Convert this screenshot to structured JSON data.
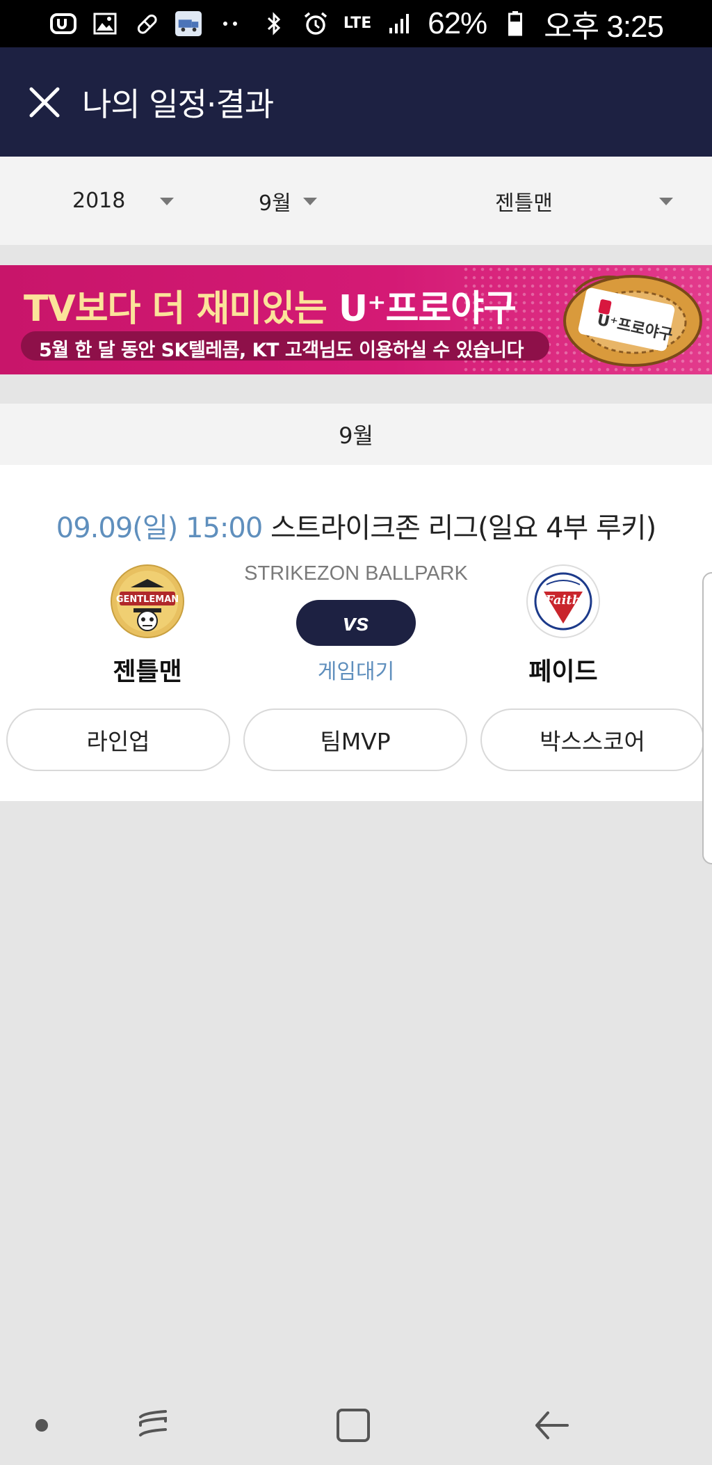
{
  "status_bar": {
    "battery": "62%",
    "time": "오후 3:25",
    "network": "LTE",
    "icons": [
      "u-plus-icon",
      "image-icon",
      "pill-icon",
      "truck-app-icon",
      "more-dots-icon",
      "bluetooth-icon",
      "alarm-icon",
      "lte-icon",
      "signal-icon",
      "battery-icon"
    ]
  },
  "header": {
    "title": "나의 일정·결과",
    "close_icon": "close-icon"
  },
  "filters": {
    "year": "2018",
    "month": "9월",
    "team": "젠틀맨"
  },
  "banner": {
    "headline_prefix": "TV보다 더 재미있는 ",
    "headline_brand": "U⁺프로야구",
    "subtext": "5월 한 달 동안 SK텔레콤, KT 고객님도 이용하실 수 있습니다",
    "glove_label": "U⁺프로야구"
  },
  "month_section": {
    "label": "9월"
  },
  "game": {
    "datetime": "09.09(일) 15:00",
    "league": "스트라이크존 리그(일요 4부 루키)",
    "venue": "STRIKEZON BALLPARK",
    "vs_label": "vs",
    "status": "게임대기",
    "home_team": {
      "name": "젠틀맨",
      "logo_text": "GENTLEMAN"
    },
    "away_team": {
      "name": "페이드",
      "logo_text": "Faith"
    },
    "buttons": {
      "lineup": "라인업",
      "team_mvp": "팀MVP",
      "box_score": "박스스코어"
    }
  },
  "colors": {
    "header_bg": "#1d2142",
    "accent_blue": "#5f8fbd",
    "banner_pink": "#d41a75",
    "page_bg": "#e5e5e5"
  }
}
